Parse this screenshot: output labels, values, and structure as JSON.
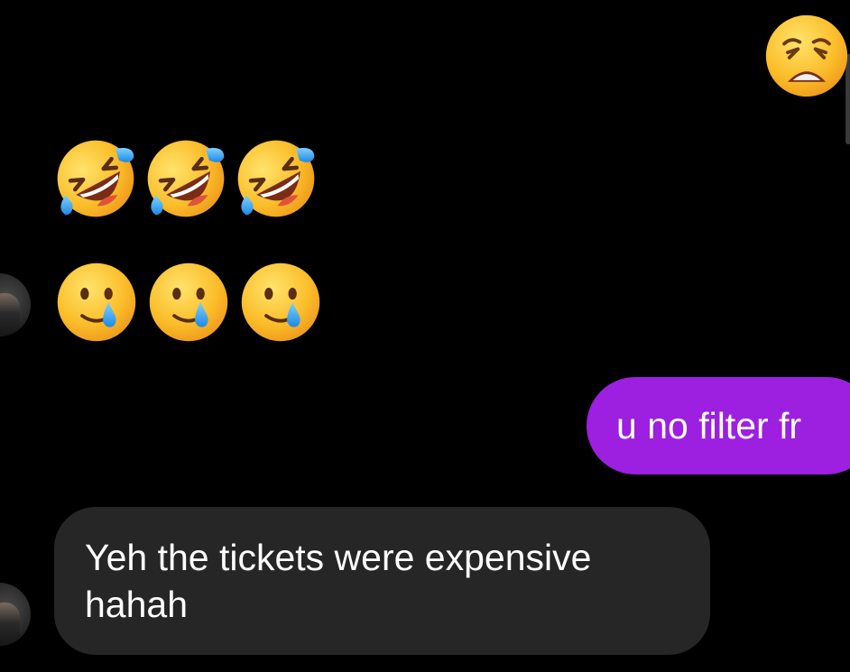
{
  "thread": {
    "messages": [
      {
        "sender": "me",
        "kind": "emoji",
        "emojis": [
          "weary-face"
        ]
      },
      {
        "sender": "them",
        "kind": "emoji",
        "emojis": [
          "rolling-on-floor-laughing",
          "rolling-on-floor-laughing",
          "rolling-on-floor-laughing"
        ]
      },
      {
        "sender": "them",
        "kind": "emoji",
        "emojis": [
          "smiling-face-with-tear",
          "smiling-face-with-tear",
          "smiling-face-with-tear"
        ]
      },
      {
        "sender": "me",
        "kind": "text",
        "text": "u no filter fr"
      },
      {
        "sender": "them",
        "kind": "text",
        "text": "Yeh the tickets were expensive hahah"
      }
    ]
  },
  "colors": {
    "background": "#000000",
    "sent_bubble": "#9d1fe0",
    "received_bubble": "#262626",
    "text": "#ffffff",
    "emoji_face": "#f9bb2a"
  }
}
